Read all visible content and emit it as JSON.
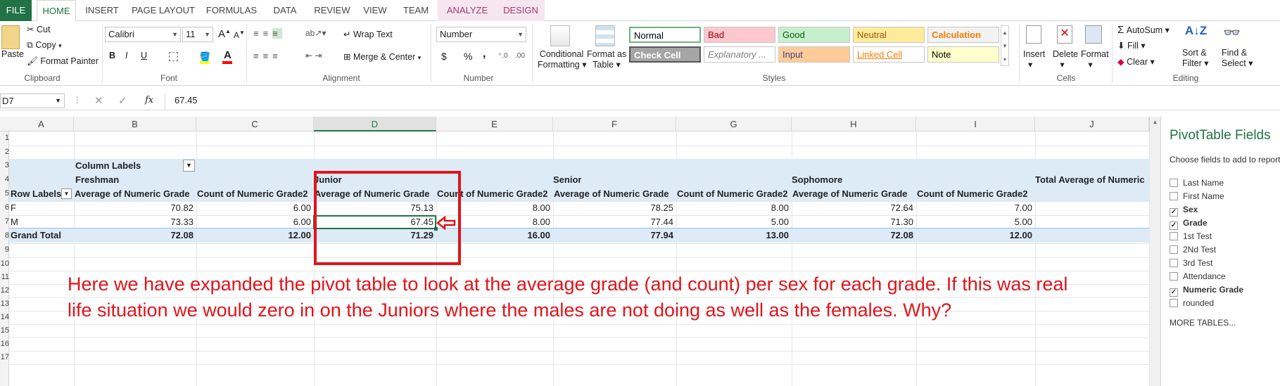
{
  "tabs": [
    "FILE",
    "HOME",
    "INSERT",
    "PAGE LAYOUT",
    "FORMULAS",
    "DATA",
    "REVIEW",
    "VIEW",
    "TEAM",
    "ANALYZE",
    "DESIGN"
  ],
  "clipboard": {
    "paste": "Paste",
    "cut": "Cut",
    "copy": "Copy",
    "format_painter": "Format Painter",
    "label": "Clipboard"
  },
  "font": {
    "name": "Calibri",
    "size": "11",
    "label": "Font",
    "bold": "B",
    "italic": "I",
    "underline": "U"
  },
  "alignment": {
    "wrap": "Wrap Text",
    "merge": "Merge & Center",
    "label": "Alignment"
  },
  "number": {
    "format": "Number",
    "label": "Number",
    "currency": "$",
    "percent": "%",
    "comma": ","
  },
  "styles": {
    "conditional": "Conditional",
    "conditional2": "Formatting",
    "format_as": "Format as",
    "format_as2": "Table",
    "cells": [
      {
        "name": "Normal",
        "bg": "#ffffff",
        "fg": "#000000"
      },
      {
        "name": "Bad",
        "bg": "#ffc7ce",
        "fg": "#9c0006"
      },
      {
        "name": "Good",
        "bg": "#c6efce",
        "fg": "#006100"
      },
      {
        "name": "Neutral",
        "bg": "#ffeb9c",
        "fg": "#9c5700"
      },
      {
        "name": "Calculation",
        "bg": "#f2f2f2",
        "fg": "#fa7d00"
      },
      {
        "name": "Check Cell",
        "bg": "#a5a5a5",
        "fg": "#ffffff"
      },
      {
        "name": "Explanatory ...",
        "bg": "#ffffff",
        "fg": "#7f7f7f"
      },
      {
        "name": "Input",
        "bg": "#ffcc99",
        "fg": "#3f3f76"
      },
      {
        "name": "Linked Cell",
        "bg": "#ffffff",
        "fg": "#fa7d00"
      },
      {
        "name": "Note",
        "bg": "#ffffcc",
        "fg": "#000000"
      }
    ],
    "label": "Styles"
  },
  "cells_group": {
    "insert": "Insert",
    "delete": "Delete",
    "format": "Format",
    "label": "Cells"
  },
  "editing": {
    "autosum": "AutoSum",
    "fill": "Fill",
    "clear": "Clear",
    "sort": "Sort &",
    "sort2": "Filter",
    "find": "Find &",
    "find2": "Select",
    "label": "Editing"
  },
  "formula_bar": {
    "name_box": "D7",
    "fx": "fx",
    "value": "67.45"
  },
  "columns": [
    "A",
    "B",
    "C",
    "D",
    "E",
    "F",
    "G",
    "H",
    "I",
    "J"
  ],
  "rows": [
    "1",
    "2",
    "3",
    "4",
    "5",
    "6",
    "7",
    "8",
    "9",
    "10",
    "11",
    "12",
    "13",
    "14",
    "15",
    "16",
    "17"
  ],
  "pivot": {
    "column_labels": "Column Labels",
    "row_labels": "Row Labels",
    "groups": [
      "Freshman",
      "Junior",
      "Senior",
      "Sophomore"
    ],
    "total_header": "Total Average of Numeric",
    "avg_header": "Average of Numeric Grade",
    "count_header": "Count of Numeric Grade2",
    "data_rows": [
      {
        "label": "F",
        "values": [
          "70.82",
          "6.00",
          "75.13",
          "8.00",
          "78.25",
          "8.00",
          "72.64",
          "7.00"
        ]
      },
      {
        "label": "M",
        "values": [
          "73.33",
          "6.00",
          "67.45",
          "8.00",
          "77.44",
          "5.00",
          "71.30",
          "5.00"
        ]
      },
      {
        "label": "Grand Total",
        "values": [
          "72.08",
          "12.00",
          "71.29",
          "16.00",
          "77.94",
          "13.00",
          "72.08",
          "12.00"
        ]
      }
    ]
  },
  "annotation": "Here we have expanded the pivot table to look at the average grade (and count) per sex for each grade. If this was real life situation we would zero in on the Juniors where the males are not doing as well as the females. Why?",
  "pane": {
    "title": "PivotTable Fields",
    "subtitle": "Choose fields to add to report:",
    "fields": [
      {
        "name": "Last Name",
        "checked": false
      },
      {
        "name": "First Name",
        "checked": false
      },
      {
        "name": "Sex",
        "checked": true
      },
      {
        "name": "Grade",
        "checked": true
      },
      {
        "name": "1st Test",
        "checked": false
      },
      {
        "name": "2Nd Test",
        "checked": false
      },
      {
        "name": "3rd Test",
        "checked": false
      },
      {
        "name": "Attendance",
        "checked": false
      },
      {
        "name": "Numeric Grade",
        "checked": true
      },
      {
        "name": "rounded",
        "checked": false
      }
    ],
    "more": "MORE TABLES..."
  }
}
